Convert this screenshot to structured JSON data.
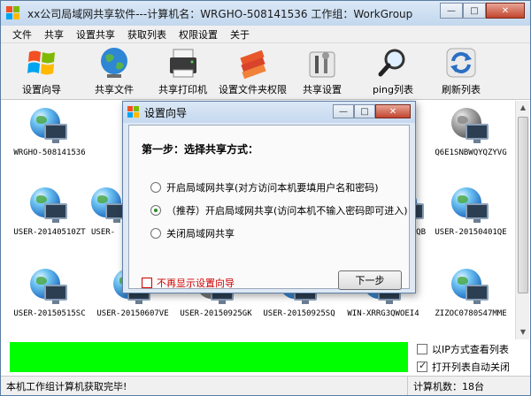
{
  "window": {
    "title": "xx公司局域网共享软件---计算机名：WRGHO-508141536  工作组：WorkGroup",
    "minimize_glyph": "—",
    "maximize_glyph": "□",
    "close_glyph": "✕"
  },
  "menu": [
    "文件",
    "共享",
    "设置共享",
    "获取列表",
    "权限设置",
    "关于"
  ],
  "toolbar": [
    {
      "label": "设置向导",
      "icon": "windows-logo-icon"
    },
    {
      "label": "共享文件",
      "icon": "globe-icon"
    },
    {
      "label": "共享打印机",
      "icon": "printer-icon"
    },
    {
      "label": "设置文件夹权限",
      "icon": "books-icon"
    },
    {
      "label": "共享设置",
      "icon": "tools-icon"
    },
    {
      "label": "ping列表",
      "icon": "magnifier-icon"
    },
    {
      "label": "刷新列表",
      "icon": "refresh-icon"
    }
  ],
  "computers": [
    {
      "name": "WRGHO-508141536",
      "status": "online"
    },
    {
      "name": "Q6E1SNBWQYQZYVG",
      "status": "offline"
    },
    {
      "name": "USER-20140510ZT",
      "status": "online"
    },
    {
      "name": "USER-",
      "status": "online"
    },
    {
      "name": "QB",
      "status": "online"
    },
    {
      "name": "USER-20150401QE",
      "status": "online"
    },
    {
      "name": "USER-20150515SC",
      "status": "online"
    },
    {
      "name": "USER-20150607VE",
      "status": "online"
    },
    {
      "name": "USER-20150925GK",
      "status": "offline"
    },
    {
      "name": "USER-20150925SQ",
      "status": "online"
    },
    {
      "name": "WIN-XRRG3QWOEI4",
      "status": "online"
    },
    {
      "name": "ZIZOC0780S47MME",
      "status": "online"
    }
  ],
  "options": {
    "ip_view": {
      "label": "以IP方式查看列表",
      "checked": false
    },
    "auto_close": {
      "label": "打开列表自动关闭",
      "checked": true
    }
  },
  "status": {
    "left": "本机工作组计算机获取完毕!",
    "right": "计算机数：18台"
  },
  "dialog": {
    "title": "设置向导",
    "step": "第一步：选择共享方式：",
    "radios": [
      {
        "label": "开启局域网共享(对方访问本机要填用户名和密码)",
        "selected": false
      },
      {
        "label": "（推荐）开启局域网共享(访问本机不输入密码即可进入)",
        "selected": true
      },
      {
        "label": "关闭局域网共享",
        "selected": false
      }
    ],
    "no_show_label": "不再显示设置向导",
    "next_label": "下一步"
  }
}
